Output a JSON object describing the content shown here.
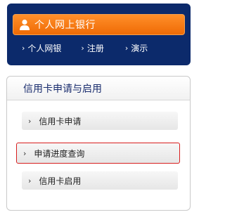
{
  "bank": {
    "main_button_label": "个人网上银行",
    "links": [
      {
        "label": "个人网银"
      },
      {
        "label": "注册"
      },
      {
        "label": "演示"
      }
    ]
  },
  "credit_card": {
    "title": "信用卡申请与启用",
    "items": [
      {
        "label": "信用卡申请"
      },
      {
        "label": "申请进度查询"
      },
      {
        "label": "信用卡启用"
      }
    ]
  },
  "colors": {
    "bank_bg": "#0c2a6b",
    "button_orange": "#ef6b05",
    "highlight_border": "#d81e1e"
  }
}
